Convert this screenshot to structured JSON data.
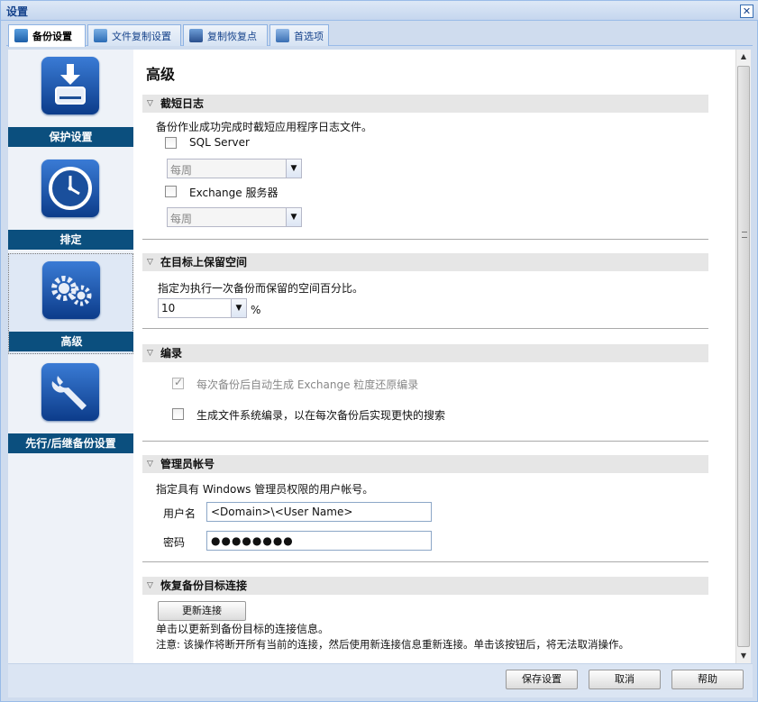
{
  "window": {
    "title": "设置",
    "close_icon": "close-icon"
  },
  "tabs": [
    {
      "label": "备份设置",
      "icon": "backup-icon",
      "active": true
    },
    {
      "label": "文件复制设置",
      "icon": "file-copy-icon",
      "active": false
    },
    {
      "label": "复制恢复点",
      "icon": "copy-recovery-point-icon",
      "active": false
    },
    {
      "label": "首选项",
      "icon": "preferences-icon",
      "active": false
    }
  ],
  "sidebar": {
    "items": [
      {
        "label": "保护设置",
        "icon": "hard-drive-download-icon"
      },
      {
        "label": "排定",
        "icon": "clock-icon"
      },
      {
        "label": "高级",
        "icon": "gears-icon",
        "selected": true
      },
      {
        "label": "先行/后继备份设置",
        "icon": "wrench-icon"
      }
    ]
  },
  "main": {
    "title": "高级",
    "truncate": {
      "header": "截短日志",
      "desc": "备份作业成功完成时截短应用程序日志文件。",
      "sql_label": "SQL Server",
      "sql_freq": "每周",
      "exchange_label": "Exchange 服务器",
      "exchange_freq": "每周"
    },
    "reserve": {
      "header": "在目标上保留空间",
      "desc": "指定为执行一次备份而保留的空间百分比。",
      "value": "10",
      "unit": "%"
    },
    "catalog": {
      "header": "编录",
      "exchange_catalog_label": "每次备份后自动生成 Exchange 粒度还原编录",
      "fs_catalog_label": "生成文件系统编录，以在每次备份后实现更快的搜索"
    },
    "admin": {
      "header": "管理员帐号",
      "desc": "指定具有 Windows 管理员权限的用户帐号。",
      "user_label": "用户名",
      "user_value": "<Domain>\\<User Name>",
      "pwd_label": "密码",
      "pwd_value": "●●●●●●●●"
    },
    "reconnect": {
      "header": "恢复备份目标连接",
      "button": "更新连接",
      "desc1": "单击以更新到备份目标的连接信息。",
      "desc2": "注意: 该操作将断开所有当前的连接，然后使用新连接信息重新连接。单击该按钮后，将无法取消操作。"
    }
  },
  "footer": {
    "save": "保存设置",
    "cancel": "取消",
    "help": "帮助"
  },
  "colors": {
    "accent": "#15428b",
    "nav_label_bg": "#0b4f7e",
    "section_bg": "#e6e6e6"
  }
}
